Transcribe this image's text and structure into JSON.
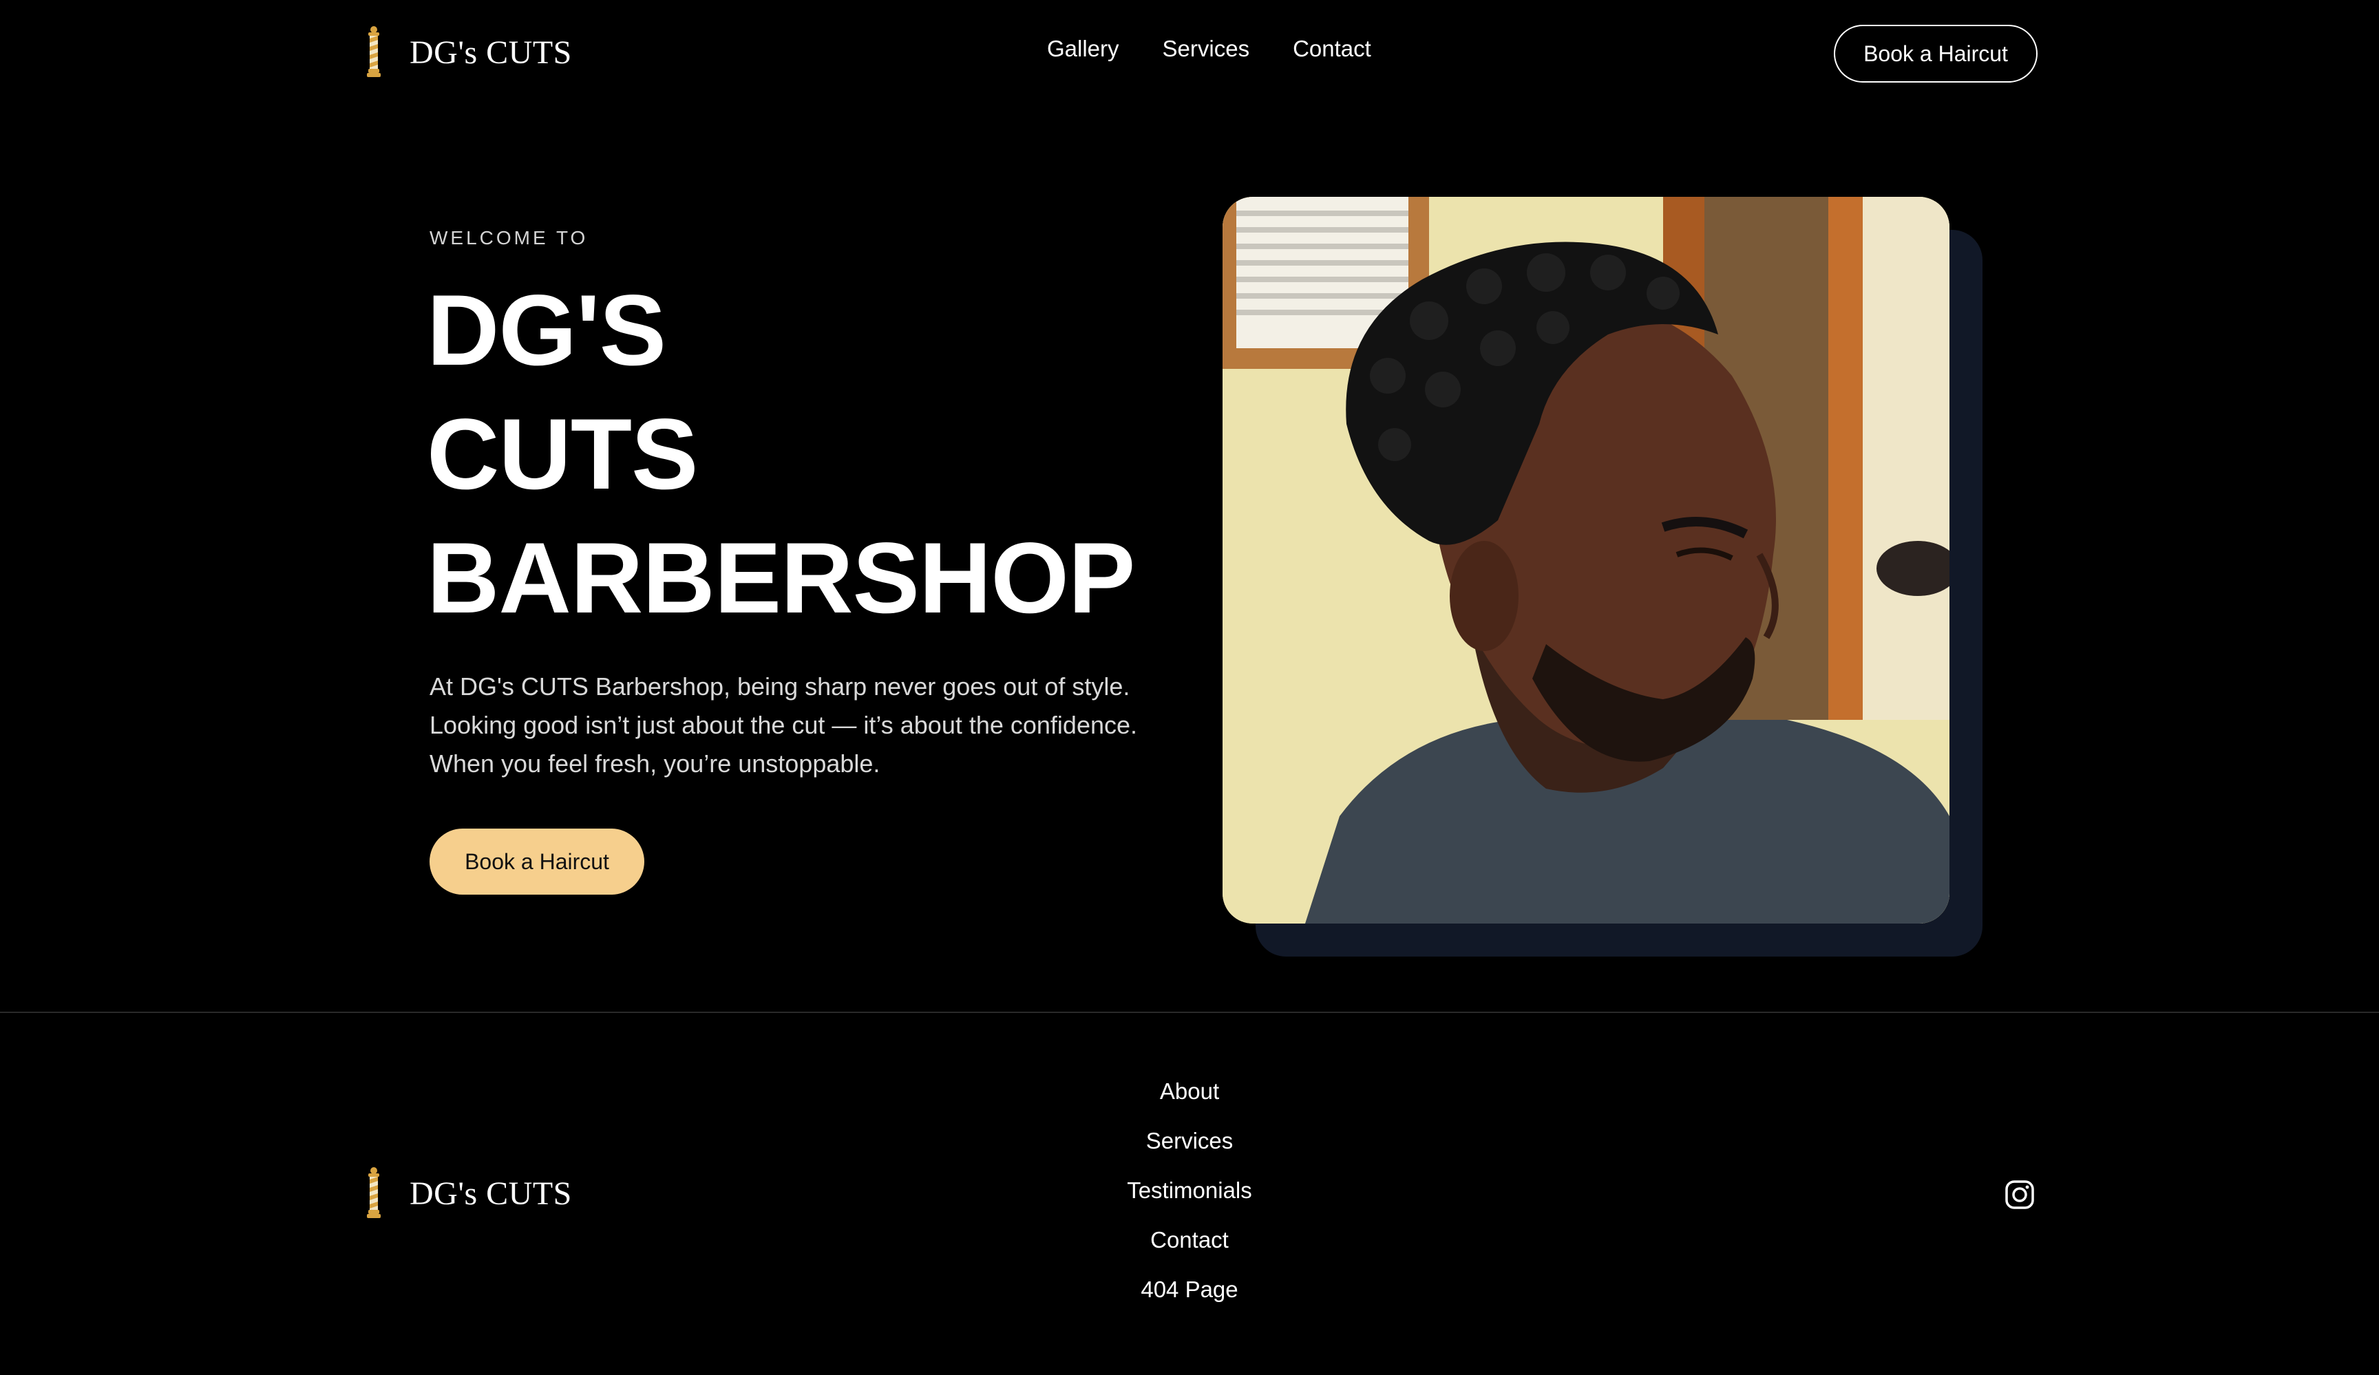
{
  "header": {
    "brand_name": "DG's CUTS",
    "brand_icon": "barber-pole-icon",
    "nav": [
      {
        "label": "Gallery"
      },
      {
        "label": "Services"
      },
      {
        "label": "Contact"
      }
    ],
    "cta_label": "Book a Haircut"
  },
  "hero": {
    "eyebrow": "WELCOME TO",
    "title_lines": [
      "DG'S",
      "CUTS",
      "BARBERSHOP"
    ],
    "description_lines": [
      "At DG's CUTS Barbershop, being sharp never goes out of style.",
      "Looking good isn’t just about the cut — it’s about the confidence.",
      "When you feel fresh, you’re unstoppable."
    ],
    "cta_label": "Book a Haircut"
  },
  "footer": {
    "brand_name": "DG's CUTS",
    "links": [
      {
        "label": "About"
      },
      {
        "label": "Services"
      },
      {
        "label": "Testimonials"
      },
      {
        "label": "Contact"
      },
      {
        "label": "404 Page"
      }
    ],
    "social_icon": "instagram-icon"
  },
  "colors": {
    "background": "#000000",
    "accent": "#f6cf8d",
    "pole_gold": "#d9a441",
    "photo_shadow": "#111827"
  }
}
